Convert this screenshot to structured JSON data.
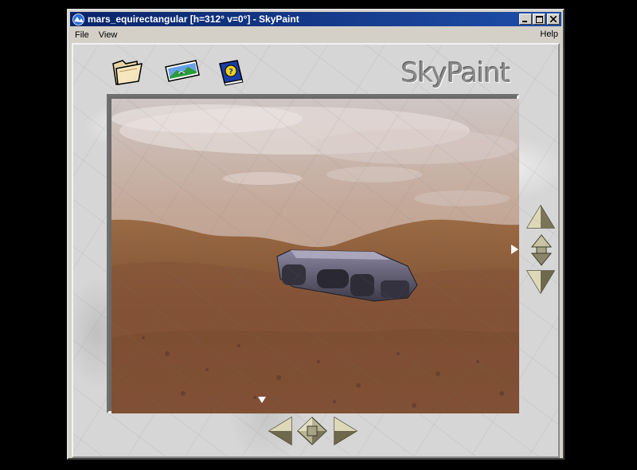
{
  "window": {
    "title": "mars_equirectangular [h=312° v=0°] - SkyPaint"
  },
  "menu": {
    "file": "File",
    "view": "View",
    "help": "Help"
  },
  "toolbar": {
    "icons": [
      "open-folder-icon",
      "panorama-image-icon",
      "help-book-icon"
    ]
  },
  "brand": {
    "logo_text": "SkyPaint"
  },
  "viewport": {
    "scene": "mars-landscape-with-rover",
    "heading_deg": 312,
    "pitch_deg": 0
  },
  "colors": {
    "title_bar": "#0a246a",
    "marble": "#d6d6d6",
    "sky": "#b89a8a",
    "ground": "#8a5a38"
  }
}
